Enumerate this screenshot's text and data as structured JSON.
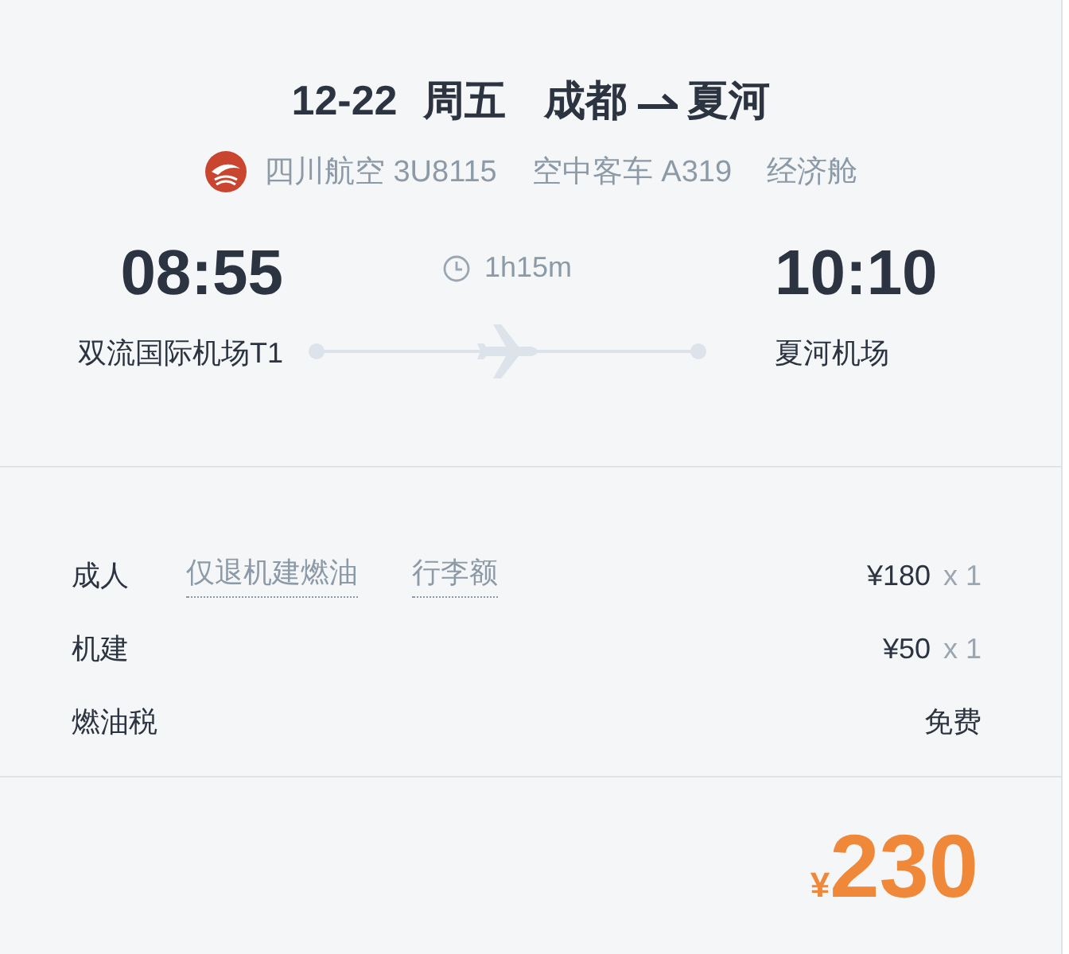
{
  "header": {
    "date": "12-22",
    "weekday": "周五",
    "from": "成都",
    "to": "夏河"
  },
  "flight_info": {
    "airline": "四川航空 3U8115",
    "aircraft": "空中客车 A319",
    "cabin": "经济舱"
  },
  "departure": {
    "time": "08:55",
    "airport": "双流国际机场T1"
  },
  "duration": "1h15m",
  "arrival": {
    "time": "10:10",
    "airport": "夏河机场"
  },
  "fares": [
    {
      "label": "成人",
      "links": [
        "仅退机建燃油",
        "行李额"
      ],
      "price": "¥180",
      "quantity": "x 1"
    },
    {
      "label": "机建",
      "price": "¥50",
      "quantity": "x 1"
    },
    {
      "label": "燃油税",
      "price": "免费"
    }
  ],
  "total": {
    "currency": "¥",
    "amount": "230"
  }
}
